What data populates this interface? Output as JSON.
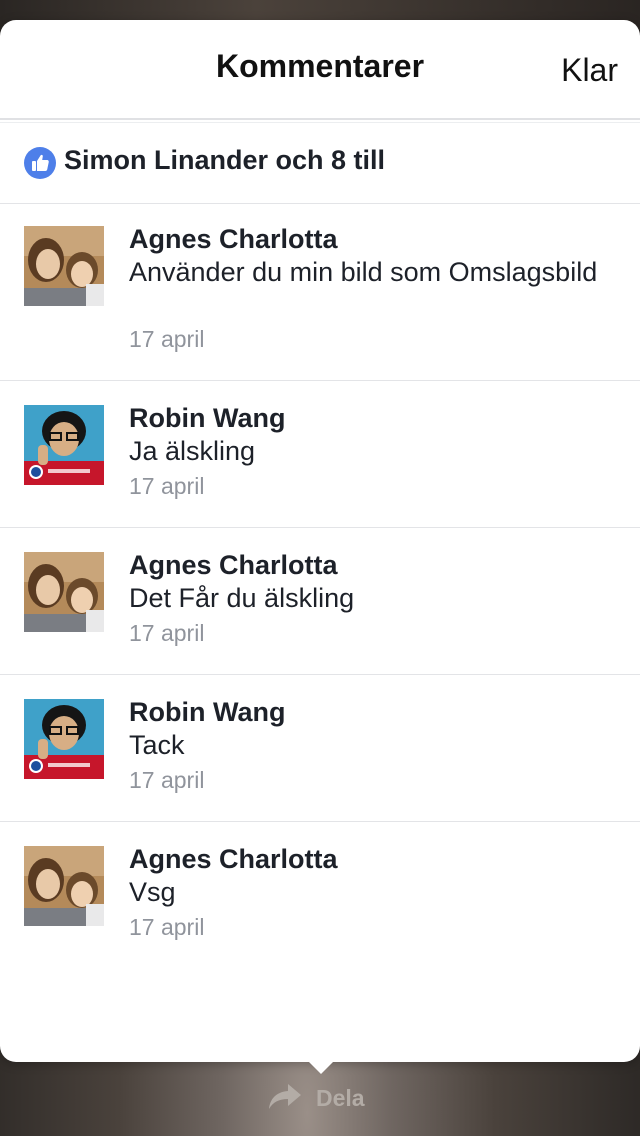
{
  "header": {
    "title": "Kommentarer",
    "done_label": "Klar"
  },
  "likes": {
    "text": "Simon Linander och 8 till",
    "icon": "thumbs-up-icon",
    "accent": "#4e7fe9"
  },
  "comments": [
    {
      "author": "Agnes Charlotta",
      "text": "Använder du min bild som Omslagsbild",
      "date": "17 april",
      "avatar": "avatar-agnes"
    },
    {
      "author": "Robin Wang",
      "text": "Ja älskling",
      "date": "17 april",
      "avatar": "avatar-robin"
    },
    {
      "author": "Agnes Charlotta",
      "text": "Det Får du älskling",
      "date": "17 april",
      "avatar": "avatar-agnes"
    },
    {
      "author": "Robin Wang",
      "text": "Tack",
      "date": "17 april",
      "avatar": "avatar-robin"
    },
    {
      "author": "Agnes Charlotta",
      "text": "Vsg",
      "date": "17 april",
      "avatar": "avatar-agnes"
    }
  ],
  "footer": {
    "share_label": "Dela",
    "share_icon": "share-arrow-icon"
  }
}
